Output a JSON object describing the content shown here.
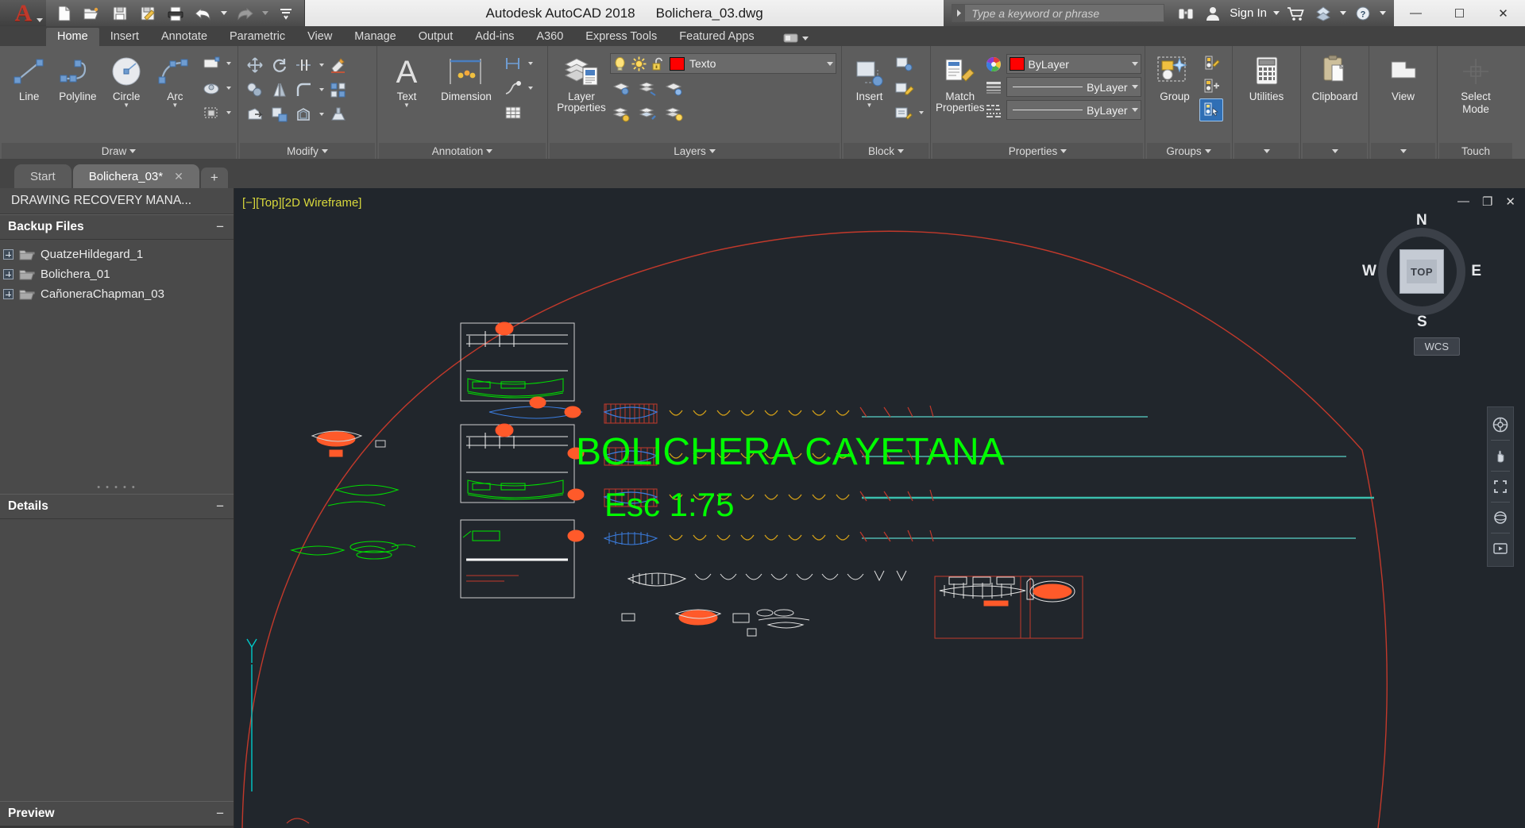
{
  "window": {
    "app_title": "Autodesk AutoCAD 2018",
    "file_title": "Bolichera_03.dwg",
    "minimize": "—",
    "maximize": "☐",
    "close": "✕"
  },
  "quick_access": {
    "items": [
      {
        "name": "new-icon",
        "label": "New"
      },
      {
        "name": "open-icon",
        "label": "Open"
      },
      {
        "name": "save-icon",
        "label": "Save"
      },
      {
        "name": "saveas-icon",
        "label": "Save As"
      },
      {
        "name": "plot-icon",
        "label": "Plot"
      },
      {
        "name": "undo-icon",
        "label": "Undo"
      },
      {
        "name": "redo-icon",
        "label": "Redo"
      },
      {
        "name": "qat-more-icon",
        "label": "Customize"
      }
    ]
  },
  "search": {
    "placeholder": "Type a keyword or phrase",
    "value": ""
  },
  "account": {
    "sign_in": "Sign In",
    "cart_icon": "cart-icon",
    "help_icon": "help-icon",
    "exchange_icon": "autodesk-exchange-icon",
    "search_icon": "binoculars-icon",
    "user_icon": "user-icon"
  },
  "ribbon": {
    "tabs": [
      {
        "label": "Home",
        "active": true
      },
      {
        "label": "Insert",
        "active": false
      },
      {
        "label": "Annotate",
        "active": false
      },
      {
        "label": "Parametric",
        "active": false
      },
      {
        "label": "View",
        "active": false
      },
      {
        "label": "Manage",
        "active": false
      },
      {
        "label": "Output",
        "active": false
      },
      {
        "label": "Add-ins",
        "active": false
      },
      {
        "label": "A360",
        "active": false
      },
      {
        "label": "Express Tools",
        "active": false
      },
      {
        "label": "Featured Apps",
        "active": false
      }
    ],
    "panels": {
      "draw": {
        "label": "Draw",
        "buttons": [
          {
            "label": "Line",
            "icon": "line-icon",
            "dropdown": false
          },
          {
            "label": "Polyline",
            "icon": "polyline-icon",
            "dropdown": false
          },
          {
            "label": "Circle",
            "icon": "circle-icon",
            "dropdown": true
          },
          {
            "label": "Arc",
            "icon": "arc-icon",
            "dropdown": true
          }
        ],
        "small": [
          {
            "icon": "rectangle-icon",
            "dropdown": true
          },
          {
            "icon": "ellipse-icon",
            "dropdown": true
          },
          {
            "icon": "block-icon",
            "dropdown": true
          }
        ]
      },
      "modify": {
        "label": "Modify",
        "small": [
          {
            "icon": "move-icon"
          },
          {
            "icon": "rotate-icon"
          },
          {
            "icon": "trim-icon",
            "dropdown": true
          },
          {
            "icon": "erase-icon"
          },
          {
            "icon": "copy-icon"
          },
          {
            "icon": "mirror-icon"
          },
          {
            "icon": "fillet-icon",
            "dropdown": true
          },
          {
            "icon": "array-icon"
          },
          {
            "icon": "stretch-icon"
          },
          {
            "icon": "scale-icon"
          },
          {
            "icon": "offset-icon",
            "dropdown": true
          },
          {
            "icon": "extrude-icon"
          }
        ]
      },
      "annotation": {
        "label": "Annotation",
        "buttons": [
          {
            "label": "Text",
            "icon": "text-icon",
            "dropdown": true
          },
          {
            "label": "Dimension",
            "icon": "dimension-icon",
            "dropdown": false
          }
        ],
        "small": [
          {
            "icon": "linear-dimension-icon",
            "dropdown": true
          },
          {
            "icon": "leader-icon",
            "dropdown": true
          },
          {
            "icon": "table-icon"
          }
        ]
      },
      "layers": {
        "label": "Layers",
        "layer_properties_label": "Layer Properties",
        "layer_properties_icon": "layer-properties-icon",
        "current_layer": {
          "name": "Texto",
          "color": "#ff0000",
          "on_icon": "lightbulb-icon",
          "freeze_icon": "sun-icon",
          "lock_icon": "unlock-icon"
        },
        "small": [
          {
            "icon": "layer-isolate-icon"
          },
          {
            "icon": "layer-freeze-icon"
          },
          {
            "icon": "layer-off-icon"
          },
          {
            "icon": "layer-unisolate-icon"
          },
          {
            "icon": "layer-match-icon"
          },
          {
            "icon": "layer-on-icon"
          },
          {
            "icon": "layer-lock-icon"
          },
          {
            "icon": "layer-previous-icon"
          },
          {
            "icon": "layer-merge-icon"
          }
        ]
      },
      "block": {
        "label": "Block",
        "buttons": [
          {
            "label": "Insert",
            "icon": "insert-block-icon",
            "dropdown": true
          }
        ],
        "small": [
          {
            "icon": "create-block-icon"
          },
          {
            "icon": "edit-block-icon"
          },
          {
            "icon": "edit-attribute-icon",
            "dropdown": true
          }
        ]
      },
      "properties": {
        "label": "Properties",
        "match_properties_label": "Match Properties",
        "match_properties_icon": "match-properties-icon",
        "color": {
          "label": "ByLayer",
          "swatch": "#ff0000",
          "icon": "color-wheel-icon"
        },
        "lineweight": {
          "label": "ByLayer",
          "icon": "lineweight-icon"
        },
        "linetype": {
          "label": "ByLayer",
          "icon": "linetype-icon"
        }
      },
      "groups": {
        "label": "Groups",
        "buttons": [
          {
            "label": "Group",
            "icon": "group-icon",
            "dropdown": false
          }
        ],
        "small": [
          {
            "icon": "group-edit-icon"
          },
          {
            "icon": "ungroup-icon"
          },
          {
            "icon": "group-selection-on-off-icon",
            "selected": true
          }
        ]
      },
      "utilities": {
        "label": "Utilities",
        "icon": "calculator-icon"
      },
      "clipboard": {
        "label": "Clipboard",
        "icon": "clipboard-icon"
      },
      "view": {
        "label": "View",
        "icon": "view-icon"
      },
      "select_mode": {
        "label_line1": "Select",
        "label_line2": "Mode",
        "sub_label": "Touch",
        "icon": "crosshair-icon"
      }
    }
  },
  "file_tabs": {
    "items": [
      {
        "label": "Start",
        "active": false,
        "closable": false
      },
      {
        "label": "Bolichera_03*",
        "active": true,
        "closable": true
      }
    ],
    "new_tab_label": "+"
  },
  "palette": {
    "title": "DRAWING RECOVERY MANA...",
    "sections": [
      {
        "title": "Backup Files",
        "collapse_icon": "minus-icon",
        "items": [
          {
            "label": "QuatzeHildegard_1",
            "icon": "folder-icon",
            "expander": "plus-icon"
          },
          {
            "label": "Bolichera_01",
            "icon": "folder-icon",
            "expander": "plus-icon"
          },
          {
            "label": "CañoneraChapman_03",
            "icon": "folder-icon",
            "expander": "plus-icon"
          }
        ]
      },
      {
        "title": "Details",
        "collapse_icon": "minus-icon",
        "items": []
      },
      {
        "title": "Preview",
        "collapse_icon": "minus-icon",
        "items": []
      }
    ]
  },
  "viewport": {
    "label": "[−][Top][2D Wireframe]",
    "minimize": "—",
    "restore": "❐",
    "close": "✕",
    "drawing_title_line1": "BOLICHERA CAYETANA",
    "drawing_title_line2": "Esc 1:75",
    "drawing_title_color": "#00ff00",
    "background_color": "#21262c",
    "ucs_label": "Y"
  },
  "viewcube": {
    "face": "TOP",
    "north": "N",
    "south": "S",
    "west": "W",
    "east": "E",
    "coordinate_system": "WCS"
  },
  "navbar": {
    "items": [
      {
        "name": "steering-wheel-icon"
      },
      {
        "name": "pan-icon"
      },
      {
        "name": "zoom-extents-icon"
      },
      {
        "name": "orbit-icon"
      },
      {
        "name": "showmotion-icon"
      }
    ]
  }
}
